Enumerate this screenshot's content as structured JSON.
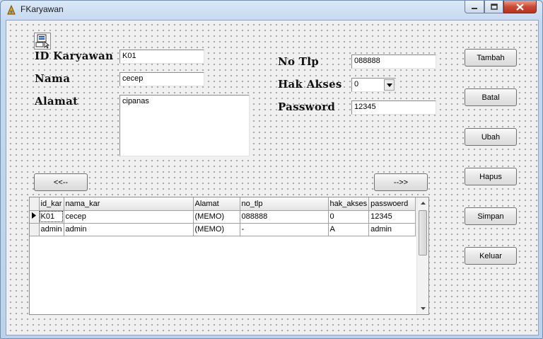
{
  "window": {
    "title": "FKaryawan",
    "controls": {
      "minimize_icon": "minimize-icon",
      "maximize_icon": "maximize-icon",
      "close_icon": "close-icon"
    }
  },
  "form": {
    "id_label": "ID Karyawan",
    "id_value": "K01",
    "nama_label": "Nama",
    "nama_value": "cecep",
    "alamat_label": "Alamat",
    "alamat_value": "cipanas",
    "notlp_label": "No Tlp",
    "notlp_value": "088888",
    "hakakses_label": "Hak Akses",
    "hakakses_value": "0",
    "password_label": "Password",
    "password_value": "12345"
  },
  "nav": {
    "prev_label": "<<--",
    "next_label": "-->>"
  },
  "buttons": {
    "tambah": "Tambah",
    "batal": "Batal",
    "ubah": "Ubah",
    "hapus": "Hapus",
    "simpan": "Simpan",
    "keluar": "Keluar"
  },
  "grid": {
    "columns": [
      "id_kar",
      "nama_kar",
      "Alamat",
      "no_tlp",
      "hak_akses",
      "passwoerd"
    ],
    "rows": [
      [
        "K01",
        "cecep",
        "(MEMO)",
        "088888",
        "0",
        "12345"
      ],
      [
        "admin",
        "admin",
        "(MEMO)",
        "-",
        "A",
        "admin"
      ]
    ]
  },
  "colors": {
    "titlebar": "#c4d8ef",
    "close_button": "#c94a35",
    "form_bg": "#f0f0f0"
  }
}
